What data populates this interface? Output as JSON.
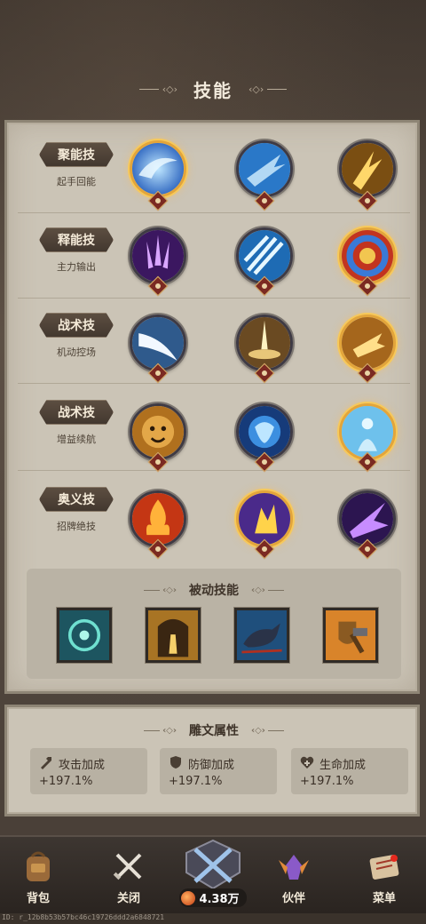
{
  "header": {
    "title": "技能",
    "deco_left": "·‹◇›·",
    "deco_right": "·‹◇›·"
  },
  "skill_rows": [
    {
      "label": "聚能技",
      "sub": "起手回能"
    },
    {
      "label": "释能技",
      "sub": "主力输出"
    },
    {
      "label": "战术技",
      "sub": "机动控场"
    },
    {
      "label": "战术技",
      "sub": "增益续航"
    },
    {
      "label": "奥义技",
      "sub": "招牌绝技"
    }
  ],
  "passive": {
    "title": "被动技能"
  },
  "rune": {
    "title": "雕文属性",
    "cards": [
      {
        "name": "攻击加成",
        "value": "+197.1%",
        "icon": "sword-icon"
      },
      {
        "name": "防御加成",
        "value": "+197.1%",
        "icon": "shield-icon"
      },
      {
        "name": "生命加成",
        "value": "+197.1%",
        "icon": "heart-plus-icon"
      }
    ]
  },
  "nav": {
    "bag": "背包",
    "close": "关闭",
    "power": "4.38万",
    "partner": "伙伴",
    "menu": "菜单"
  },
  "footer_id": "ID: r_12b8b53b57bc46c19726ddd2a6848721"
}
